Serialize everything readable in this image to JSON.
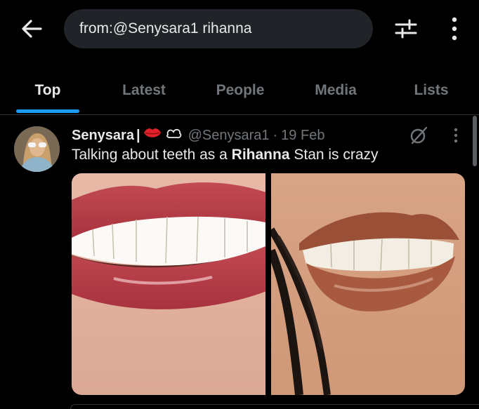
{
  "search": {
    "query": "from:@Senysara1 rihanna"
  },
  "tabs": [
    {
      "label": "Top"
    },
    {
      "label": "Latest"
    },
    {
      "label": "People"
    },
    {
      "label": "Media"
    },
    {
      "label": "Lists"
    }
  ],
  "tweet": {
    "author_name": "Senysara",
    "separator": "|",
    "emoji": "💋",
    "handle": "@Senysara1",
    "date_separator": "·",
    "date": "19 Feb",
    "text_before": "Talking about teeth as a ",
    "text_highlight": "Rihanna",
    "text_after": " Stan is crazy"
  },
  "colors": {
    "accent": "#1d9bf0",
    "background": "#000000",
    "muted": "#71767b",
    "search_bg": "#202327"
  },
  "icons": [
    "back-arrow-icon",
    "filter-sliders-icon",
    "more-vertical-icon",
    "lips-emoji-icon",
    "affiliate-badge-icon",
    "grok-icon"
  ]
}
